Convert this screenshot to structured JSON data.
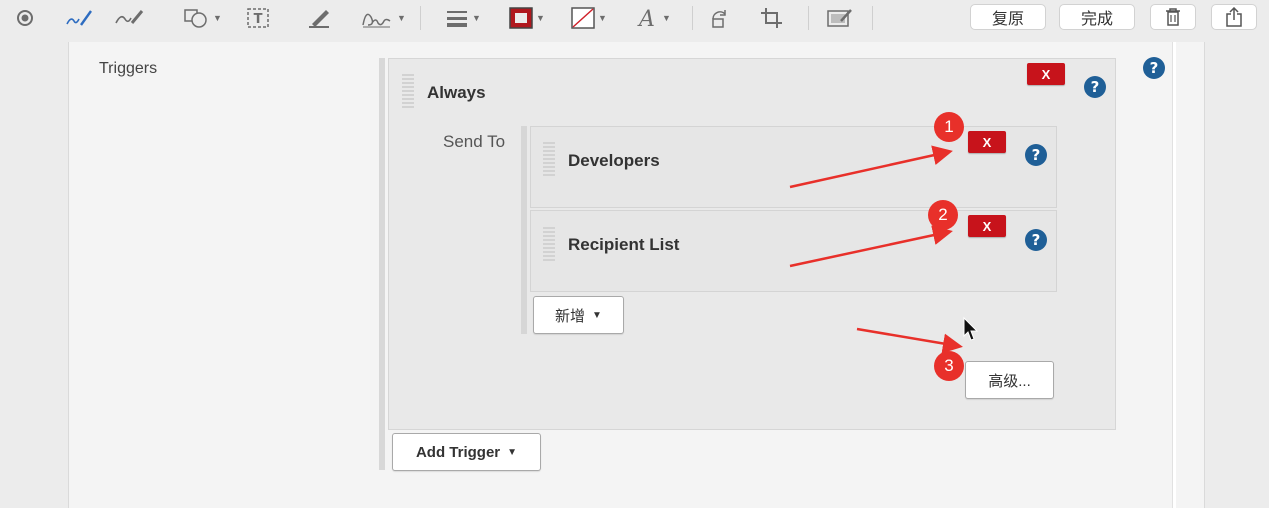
{
  "toolbar": {
    "icons": [
      "record-icon",
      "pen-icon",
      "sketch-icon",
      "shapes-icon",
      "text-box-icon",
      "highlighter-icon",
      "signature-icon",
      "line-style-icon",
      "border-color-icon",
      "fill-color-icon",
      "font-icon",
      "rotate-icon",
      "crop-icon",
      "annotate-icon"
    ],
    "revert_label": "复原",
    "done_label": "完成",
    "delete_icon": "trash-icon",
    "share_icon": "share-icon",
    "border_color": "#b0181e"
  },
  "form": {
    "triggers_label": "Triggers",
    "trigger_name": "Always",
    "remove_label": "X",
    "send_to_label": "Send To",
    "recipients": [
      {
        "name": "Developers",
        "remove_label": "X"
      },
      {
        "name": "Recipient List",
        "remove_label": "X"
      }
    ],
    "add_recipient_label": "新增",
    "advanced_label": "高级...",
    "add_trigger_label": "Add Trigger",
    "help_symbol": "?"
  },
  "annotations": {
    "badges": [
      "1",
      "2",
      "3"
    ],
    "arrow_color": "#e8302a"
  }
}
